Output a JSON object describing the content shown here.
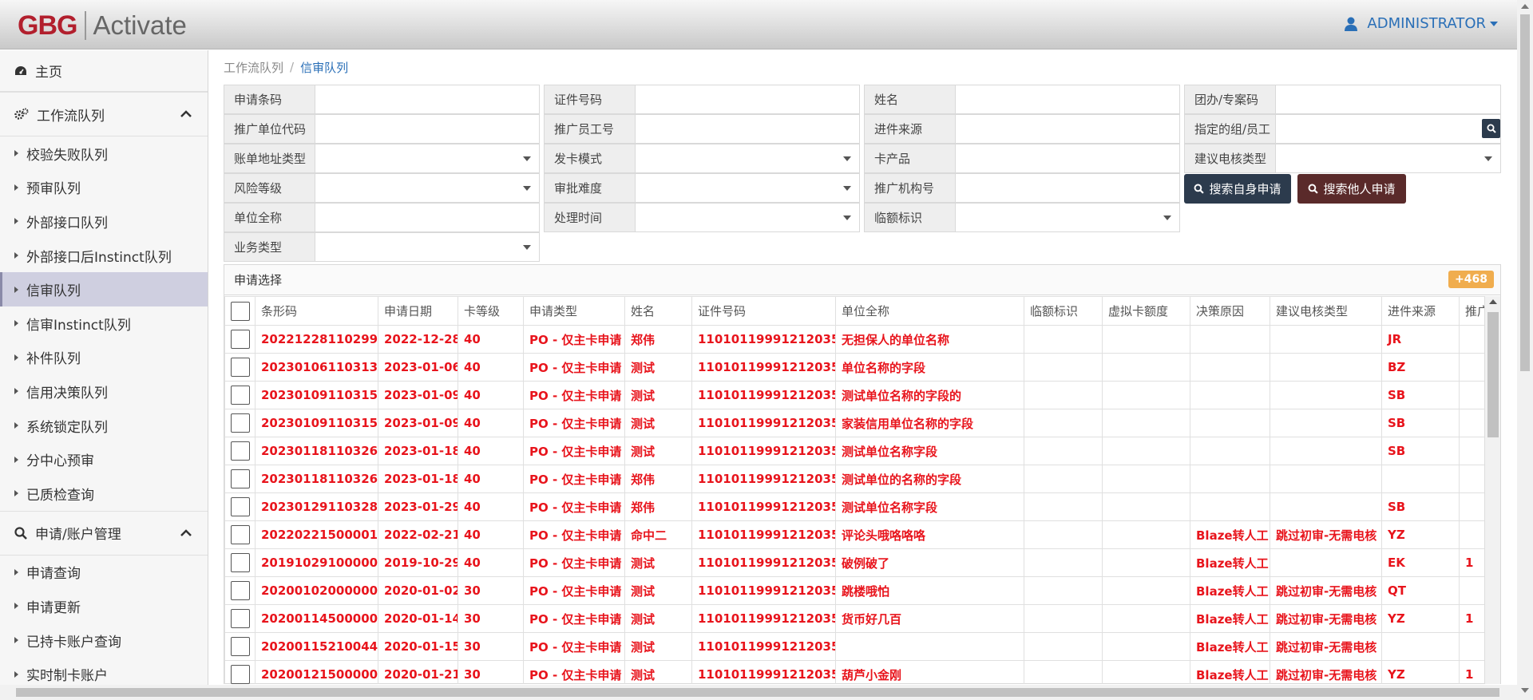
{
  "header": {
    "logo_brand": "GBG",
    "logo_product": "Activate",
    "user_name": "ADMINISTRATOR"
  },
  "sidebar": {
    "home": "主页",
    "section1": "工作流队列",
    "items1": [
      "校验失败队列",
      "预审队列",
      "外部接口队列",
      "外部接口后Instinct队列",
      "信审队列",
      "信审Instinct队列",
      "补件队列",
      "信用决策队列",
      "系统锁定队列",
      "分中心预审",
      "已质检查询"
    ],
    "section2": "申请/账户管理",
    "items2": [
      "申请查询",
      "申请更新",
      "已持卡账户查询",
      "实时制卡账户"
    ]
  },
  "breadcrumb": {
    "parent": "工作流队列",
    "current": "信审队列"
  },
  "filters": {
    "app_barcode": "申请条码",
    "id_number": "证件号码",
    "name": "姓名",
    "group_code": "团办/专案码",
    "promo_unit_code": "推广单位代码",
    "promoter_id": "推广员工号",
    "source": "进件来源",
    "assigned": "指定的组/员工",
    "bill_addr_type": "账单地址类型",
    "issue_mode": "发卡模式",
    "card_product": "卡产品",
    "suggest_call_type": "建议电核类型",
    "risk_level": "风险等级",
    "approval_difficulty": "审批难度",
    "promo_org": "推广机构号",
    "company_name": "单位全称",
    "process_time": "处理时间",
    "temp_limit_flag": "临额标识",
    "biz_type": "业务类型"
  },
  "buttons": {
    "search_self": "搜索自身申请",
    "search_others": "搜索他人申请"
  },
  "panel": {
    "title": "申请选择",
    "count_badge": "+468"
  },
  "table": {
    "columns": [
      "条形码",
      "申请日期",
      "卡等级",
      "申请类型",
      "姓名",
      "证件号码",
      "单位全称",
      "临额标识",
      "虚拟卡额度",
      "决策原因",
      "建议电核类型",
      "进件来源",
      "推广"
    ],
    "rows": [
      [
        "202212281102990",
        "2022-12-28",
        "40",
        "PO - 仅主卡申请",
        "郑伟",
        "110101199912120354",
        "无担保人的单位名称",
        "",
        "",
        "",
        "",
        "JR",
        ""
      ],
      [
        "202301061103130",
        "2023-01-06",
        "40",
        "PO - 仅主卡申请",
        "测试",
        "110101199912120354",
        "单位名称的字段",
        "",
        "",
        "",
        "",
        "BZ",
        ""
      ],
      [
        "202301091103157",
        "2023-01-09",
        "40",
        "PO - 仅主卡申请",
        "测试",
        "110101199912120354",
        "测试单位名称的字段的",
        "",
        "",
        "",
        "",
        "SB",
        ""
      ],
      [
        "202301091103158",
        "2023-01-09",
        "40",
        "PO - 仅主卡申请",
        "测试",
        "110101199912120354",
        "家装信用单位名称的字段",
        "",
        "",
        "",
        "",
        "SB",
        ""
      ],
      [
        "202301181103265",
        "2023-01-18",
        "40",
        "PO - 仅主卡申请",
        "测试",
        "110101199912120354",
        "测试单位名称字段",
        "",
        "",
        "",
        "",
        "SB",
        ""
      ],
      [
        "202301181103263",
        "2023-01-18",
        "40",
        "PO - 仅主卡申请",
        "郑伟",
        "110101199912120354",
        "测试单位的名称的字段",
        "",
        "",
        "",
        "",
        "",
        ""
      ],
      [
        "202301291103280",
        "2023-01-29",
        "40",
        "PO - 仅主卡申请",
        "郑伟",
        "110101199912120354",
        "测试单位名称字段",
        "",
        "",
        "",
        "",
        "SB",
        ""
      ],
      [
        "202202215000019",
        "2022-02-21",
        "40",
        "PO - 仅主卡申请",
        "命中二",
        "110101199912120354",
        "评论头哦咯咯咯",
        "",
        "",
        "Blaze转人工",
        "跳过初审-无需电核",
        "YZ",
        ""
      ],
      [
        "201910291000002",
        "2019-10-29",
        "40",
        "PO - 仅主卡申请",
        "测试",
        "110101199912120354",
        "破例破了",
        "",
        "",
        "Blaze转人工",
        "",
        "EK",
        "1"
      ],
      [
        "202001020000002",
        "2020-01-02",
        "30",
        "PO - 仅主卡申请",
        "测试",
        "110101199912120354",
        "跳楼哦怕",
        "",
        "",
        "Blaze转人工",
        "跳过初审-无需电核",
        "QT",
        ""
      ],
      [
        "202001145000001",
        "2020-01-14",
        "30",
        "PO - 仅主卡申请",
        "测试",
        "110101199912120354",
        "货币好几百",
        "",
        "",
        "Blaze转人工",
        "跳过初审-无需电核",
        "YZ",
        "1"
      ],
      [
        "202001152100444",
        "2020-01-15",
        "30",
        "PO - 仅主卡申请",
        "测试",
        "110101199912120354",
        "",
        "",
        "",
        "Blaze转人工",
        "跳过初审-无需电核",
        "",
        ""
      ],
      [
        "202001215000001",
        "2020-01-21",
        "30",
        "PO - 仅主卡申请",
        "测试",
        "110101199912120354",
        "葫芦小金刚",
        "",
        "",
        "Blaze转人工",
        "跳过初审-无需电核",
        "YZ",
        "1"
      ]
    ]
  },
  "colors": {
    "accent": "#2a6fb7",
    "row_text": "#e8141c",
    "badge": "#f0ad4e",
    "btn_self": "#2c3b4d",
    "btn_others": "#5a2a2a"
  }
}
